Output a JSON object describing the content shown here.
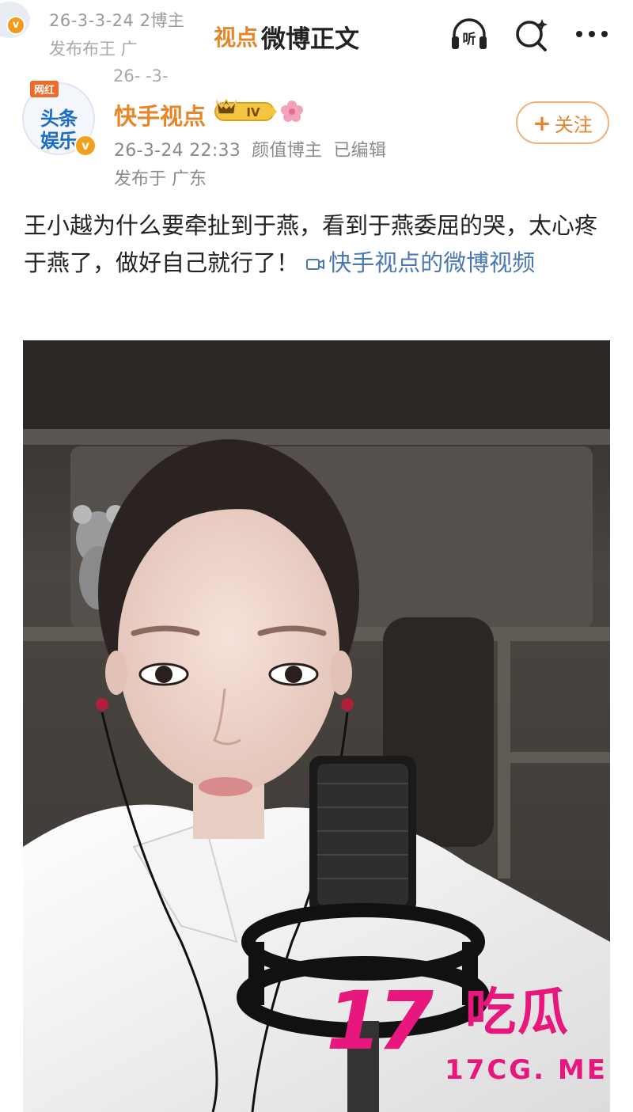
{
  "top_bar": {
    "ghost_meta_line1": "26-3-3-24 2博主",
    "ghost_meta_line2": "发布布王 广",
    "ghost_name": "视点",
    "title": "微博正文",
    "listen_icon_label": "听"
  },
  "post": {
    "ghost_date": "26-   -3-",
    "avatar": {
      "tag": "网红",
      "line1": "头条",
      "line2": "娱乐",
      "badge": "v"
    },
    "username": "快手视点",
    "level_badge": "IV",
    "date": "26-3-24 22:33",
    "role": "颜值博主",
    "edited": "已编辑",
    "location": "发布于 广东",
    "follow_label": "关注",
    "follow_plus": "+",
    "body_text": "王小越为什么要牵扯到于燕，看到于燕委屈的哭，太心疼于燕了，做好自己就行了！",
    "video_link_text": "快手视点的微博视频"
  },
  "watermark": {
    "number": "17",
    "chinese": "吃瓜",
    "url": "17CG. ME"
  },
  "colors": {
    "username": "#e5862a",
    "link": "#4a78b2",
    "meta": "#8a8a8a",
    "watermark": "#e8177e"
  }
}
